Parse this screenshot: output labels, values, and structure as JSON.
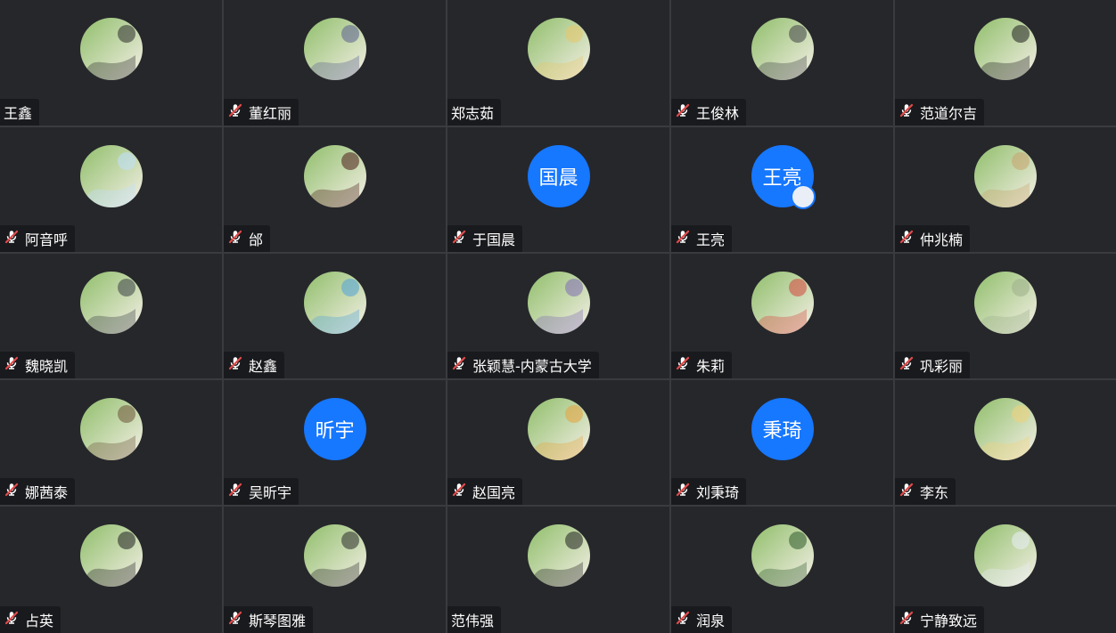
{
  "participants": [
    {
      "name": "王鑫",
      "muted_icon": false,
      "avatar": {
        "kind": "photo",
        "colors": [
          "#8fbe6a",
          "#f6f0e8",
          "#2b2b2b"
        ]
      }
    },
    {
      "name": "董红丽",
      "muted_icon": true,
      "avatar": {
        "kind": "photo",
        "colors": [
          "#b9b7e8",
          "#e8e6f8",
          "#5a5f8e"
        ]
      }
    },
    {
      "name": "郑志茹",
      "muted_icon": false,
      "avatar": {
        "kind": "photo",
        "colors": [
          "#f4f1e8",
          "#2c2c2c",
          "#e9c76a"
        ]
      }
    },
    {
      "name": "王俊林",
      "muted_icon": true,
      "avatar": {
        "kind": "photo",
        "colors": [
          "#6f7378",
          "#b9a68f",
          "#3f4246"
        ]
      }
    },
    {
      "name": "范道尔吉",
      "muted_icon": true,
      "avatar": {
        "kind": "photo",
        "colors": [
          "#f5ece2",
          "#d23a2f",
          "#1f1f1f"
        ]
      }
    },
    {
      "name": "阿音呼",
      "muted_icon": true,
      "avatar": {
        "kind": "photo",
        "colors": [
          "#4f90d8",
          "#4e7c3a",
          "#bfe0ff"
        ]
      }
    },
    {
      "name": "邰",
      "muted_icon": true,
      "avatar": {
        "kind": "photo",
        "colors": [
          "#b12a2a",
          "#e6c1a2",
          "#4a1c18"
        ]
      }
    },
    {
      "name": "于国晨",
      "muted_icon": true,
      "avatar": {
        "kind": "text",
        "text": "国晨"
      }
    },
    {
      "name": "王亮",
      "muted_icon": true,
      "avatar": {
        "kind": "text",
        "text": "王亮",
        "badge": true
      }
    },
    {
      "name": "仲兆楠",
      "muted_icon": true,
      "avatar": {
        "kind": "photo",
        "colors": [
          "#f3f3f0",
          "#f2c629",
          "#c9a36e"
        ]
      }
    },
    {
      "name": "魏晓凯",
      "muted_icon": true,
      "avatar": {
        "kind": "photo",
        "colors": [
          "#8fa7c4",
          "#dfe7ef",
          "#3a3f46"
        ]
      }
    },
    {
      "name": "赵鑫",
      "muted_icon": true,
      "avatar": {
        "kind": "photo",
        "colors": [
          "#21364f",
          "#d0872c",
          "#4fa2d8"
        ]
      }
    },
    {
      "name": "张颖慧-内蒙古大学",
      "muted_icon": true,
      "avatar": {
        "kind": "photo",
        "colors": [
          "#efe8f1",
          "#f2c94c",
          "#7f6bb5"
        ]
      }
    },
    {
      "name": "朱莉",
      "muted_icon": true,
      "avatar": {
        "kind": "photo",
        "colors": [
          "#fafafa",
          "#f3a6b9",
          "#d6453c"
        ]
      }
    },
    {
      "name": "巩彩丽",
      "muted_icon": true,
      "avatar": {
        "kind": "photo",
        "colors": [
          "#4a5a3a",
          "#f1d21a",
          "#9caf8a"
        ]
      }
    },
    {
      "name": "娜茜泰",
      "muted_icon": true,
      "avatar": {
        "kind": "photo",
        "colors": [
          "#f2ede4",
          "#c8a87a",
          "#6b5436"
        ]
      }
    },
    {
      "name": "吴昕宇",
      "muted_icon": true,
      "avatar": {
        "kind": "text",
        "text": "昕宇"
      }
    },
    {
      "name": "赵国亮",
      "muted_icon": true,
      "avatar": {
        "kind": "photo",
        "colors": [
          "#0f1412",
          "#1f5aa8",
          "#e7a23c"
        ]
      }
    },
    {
      "name": "刘秉琦",
      "muted_icon": true,
      "avatar": {
        "kind": "text",
        "text": "秉琦"
      }
    },
    {
      "name": "李东",
      "muted_icon": true,
      "avatar": {
        "kind": "photo",
        "colors": [
          "#2c7a4b",
          "#d64a2a",
          "#f0d27a"
        ]
      }
    },
    {
      "name": "占英",
      "muted_icon": true,
      "avatar": {
        "kind": "photo",
        "colors": [
          "#8ed26b",
          "#5fb54a",
          "#1f1f1f"
        ]
      }
    },
    {
      "name": "斯琴图雅",
      "muted_icon": true,
      "avatar": {
        "kind": "photo",
        "colors": [
          "#f0c36a",
          "#8a5a1a",
          "#2a2a2a"
        ]
      }
    },
    {
      "name": "范伟强",
      "muted_icon": false,
      "avatar": {
        "kind": "photo",
        "colors": [
          "#3d4a34",
          "#a7b3a0",
          "#1f1f1f"
        ]
      }
    },
    {
      "name": "润泉",
      "muted_icon": true,
      "avatar": {
        "kind": "photo",
        "colors": [
          "#2f8fe7",
          "#9fd7ff",
          "#2e5a2a"
        ]
      }
    },
    {
      "name": "宁静致远",
      "muted_icon": true,
      "avatar": {
        "kind": "photo",
        "colors": [
          "#0f2f88",
          "#1b56c9",
          "#e9eef7"
        ]
      }
    }
  ],
  "theme": {
    "tile_bg": "#26272b",
    "separator": "#3a3b3f",
    "name_tag_bg": "#191a1d",
    "text_avatar_bg": "#1677ff",
    "mic_muted_color": "#e24b4b"
  }
}
